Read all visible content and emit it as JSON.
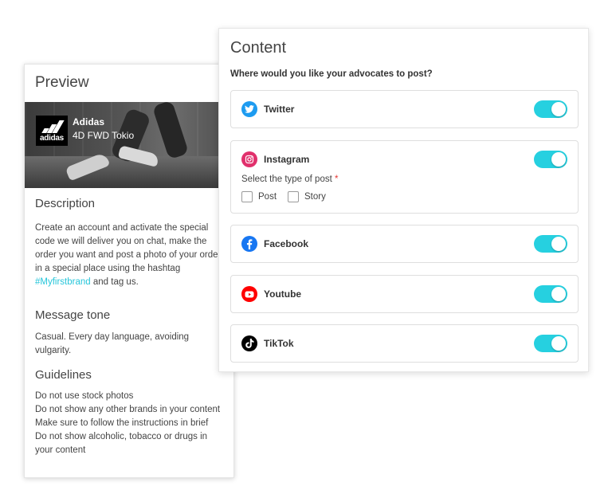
{
  "preview": {
    "title": "Preview",
    "brand_name": "Adidas",
    "brand_logo_text": "adidas",
    "product_name": "4D FWD Tokio",
    "description_heading": "Description",
    "description_text": "Create an account and activate the special code we will deliver you on chat, make the order you want and post a photo of your order in a special place using the hashtag ",
    "hashtag": "#Myfirstbrand",
    "description_suffix": " and tag us.",
    "tone_heading": "Message tone",
    "tone_text": "Casual. Every day language, avoiding vulgarity.",
    "guidelines_heading": "Guidelines",
    "guidelines": [
      "Do not use stock photos",
      "Do not show any other brands in your content",
      "Make sure to follow the instructions in brief",
      "Do not show alcoholic, tobacco or drugs in your content"
    ]
  },
  "content": {
    "title": "Content",
    "question": "Where would you like your advocates to post?",
    "networks": [
      {
        "name": "Twitter",
        "icon": "twitter-icon",
        "color": "#1d9bf0",
        "enabled": true
      },
      {
        "name": "Instagram",
        "icon": "instagram-icon",
        "color": "#e1306c",
        "enabled": true
      },
      {
        "name": "Facebook",
        "icon": "facebook-icon",
        "color": "#1877f2",
        "enabled": true
      },
      {
        "name": "Youtube",
        "icon": "youtube-icon",
        "color": "#ff0000",
        "enabled": true
      },
      {
        "name": "TikTok",
        "icon": "tiktok-icon",
        "color": "#000000",
        "enabled": true
      }
    ],
    "instagram_post_type": {
      "label": "Select the type of post",
      "required_mark": "*",
      "options": [
        "Post",
        "Story"
      ]
    }
  },
  "colors": {
    "accent": "#26d0e0",
    "hashtag": "#26c6da"
  }
}
